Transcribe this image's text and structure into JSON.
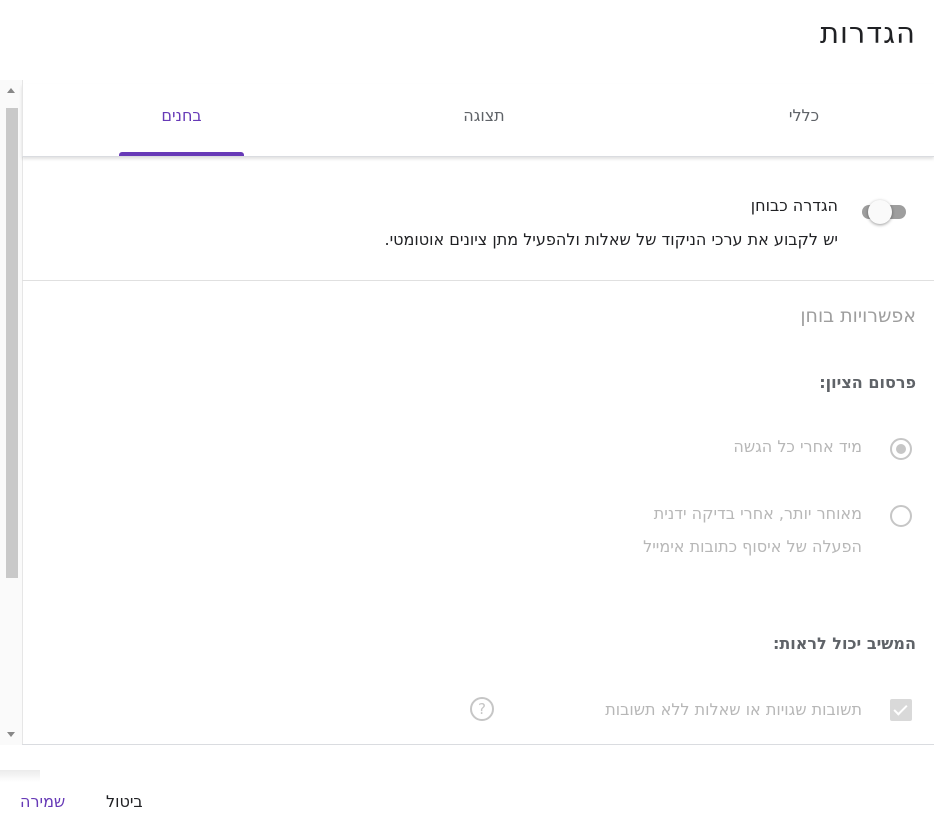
{
  "dialog": {
    "title": "הגדרות"
  },
  "tabs": [
    {
      "label": "כללי",
      "active": false
    },
    {
      "label": "תצוגה",
      "active": false
    },
    {
      "label": "בחנים",
      "active": true
    }
  ],
  "quiz_toggle": {
    "label": "הגדרה כבוחן",
    "description": "יש לקבוע את ערכי הניקוד של שאלות ולהפעיל מתן ציונים אוטומטי.",
    "enabled": false
  },
  "quiz_options": {
    "title": "אפשרויות בוחן",
    "release_grade": {
      "label": "פרסום הציון:",
      "options": [
        {
          "label": "מיד אחרי כל הגשה",
          "selected": true,
          "disabled": true
        },
        {
          "label": "מאוחר יותר, אחרי בדיקה ידנית",
          "sublabel": "הפעלה של איסוף כתובות אימייל",
          "selected": false,
          "disabled": true
        }
      ]
    },
    "respondent_can_see": {
      "label": "המשיב יכול לראות:",
      "checkbox_label": "תשובות שגויות או שאלות ללא תשובות",
      "checked": true,
      "disabled": true,
      "help_icon": "?"
    }
  },
  "footer": {
    "save_label": "שמירה",
    "cancel_label": "ביטול"
  },
  "colors": {
    "accent": "#673ab7",
    "disabled": "#b7b7b7"
  }
}
